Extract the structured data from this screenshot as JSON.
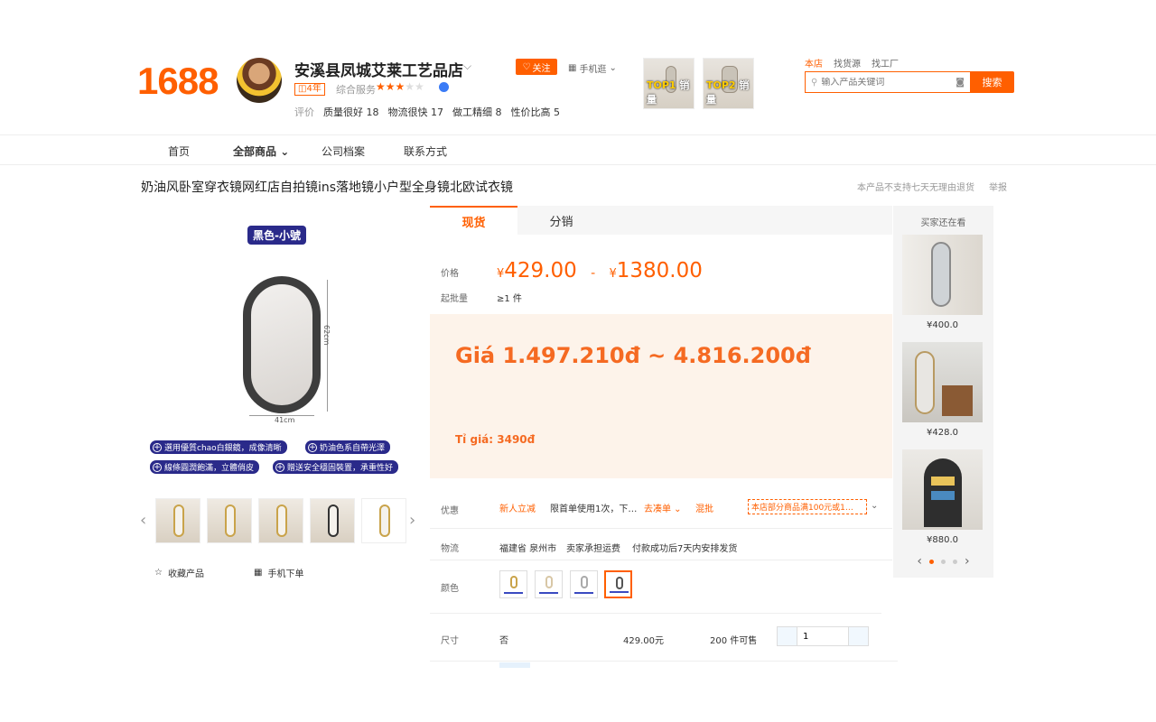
{
  "header": {
    "logo": "1688",
    "shop_name": "安溪县凤城艾莱工艺品店",
    "years_badge": "4年",
    "service_label": "综合服务",
    "stars_on": "★★★",
    "stars_off": "★★",
    "follow_label": "关注",
    "mobile_label": "手机逛",
    "rating_prefix": "评价",
    "ratings": [
      "质量很好 18",
      "物流很快 17",
      "做工精细 8",
      "性价比高 5"
    ],
    "top_thumbs": [
      {
        "rank": "TOP1",
        "label": "销量"
      },
      {
        "rank": "TOP2",
        "label": "销量"
      }
    ],
    "search_tabs": [
      "本店",
      "找货源",
      "找工厂"
    ],
    "search_placeholder": "输入产品关键词",
    "search_button": "搜索"
  },
  "nav": [
    "首页",
    "全部商品",
    "公司档案",
    "联系方式"
  ],
  "product": {
    "title": "奶油风卧室穿衣镜网红店自拍镜ins落地镜小户型全身镜北欧试衣镜",
    "no_return": "本产品不支持七天无理由退货",
    "report": "举报",
    "image_tag": "黑色-小號",
    "dim_height": "62cm",
    "dim_width": "41cm",
    "features": [
      "選用優質chao白銀鏡，成像清晰",
      "奶油色系自帶光澤",
      "線條圓潤飽滿，立體俏皮",
      "贈送安全穩固裝置，承重性好"
    ],
    "favorite": "收藏产品",
    "mobile_order": "手机下单"
  },
  "panel": {
    "tabs": [
      "现货",
      "分销"
    ],
    "price_label": "价格",
    "currency": "¥",
    "price_low": "429.00",
    "price_sep": "-",
    "price_high": "1380.00",
    "moq_label": "起批量",
    "moq_value": "≥1 件",
    "vn_price": "Giá 1.497.210đ ~ 4.816.200đ",
    "vn_rate": "Tỉ giá: 3490đ",
    "promo_label": "优惠",
    "promo_new": "新人立减",
    "promo_first": "限首单使用1次，下…",
    "promo_collect": "去凑单",
    "promo_mix": "混批",
    "promo_coupon": "本店部分商品满100元或1…",
    "logistics_label": "物流",
    "logistics_origin": "福建省 泉州市",
    "logistics_fee": "卖家承担运费",
    "logistics_ship": "付款成功后7天内安排发货",
    "color_label": "颜色",
    "size_label": "尺寸",
    "size_value": "否",
    "size_price": "429.00元",
    "size_stock": "200 件可售",
    "quantity": "1"
  },
  "sidebar": {
    "title": "买家还在看",
    "items": [
      {
        "price": "¥400.0"
      },
      {
        "price": "¥428.0"
      },
      {
        "price": "¥880.0"
      }
    ]
  }
}
